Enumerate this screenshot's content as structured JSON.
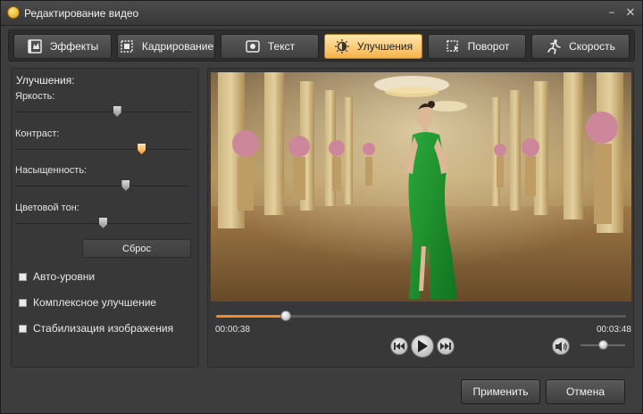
{
  "window": {
    "title": "Редактирование видео",
    "minimize_glyph": "−",
    "close_glyph": "✕"
  },
  "tabs": [
    {
      "label": "Эффекты",
      "icon": "effects-icon",
      "active": false
    },
    {
      "label": "Кадрирование",
      "icon": "crop-icon",
      "active": false
    },
    {
      "label": "Текст",
      "icon": "text-icon",
      "active": false
    },
    {
      "label": "Улучшения",
      "icon": "enhance-icon",
      "active": true
    },
    {
      "label": "Поворот",
      "icon": "rotate-icon",
      "active": false
    },
    {
      "label": "Скорость",
      "icon": "speed-icon",
      "active": false
    }
  ],
  "enhancements": {
    "heading": "Улучшения:",
    "sliders": [
      {
        "label": "Яркость:",
        "value": 0.58
      },
      {
        "label": "Контраст:",
        "value": 0.72
      },
      {
        "label": "Насыщенность:",
        "value": 0.63
      },
      {
        "label": "Цветовой тон:",
        "value": 0.5
      }
    ],
    "reset_label": "Сброс",
    "checkboxes": [
      {
        "label": "Авто-уровни",
        "checked": false
      },
      {
        "label": "Комплексное улучшение",
        "checked": false
      },
      {
        "label": "Стабилизация изображения",
        "checked": false
      }
    ]
  },
  "player": {
    "current_time": "00:00:38",
    "total_time": "00:03:48",
    "progress": 0.17,
    "volume": 0.5
  },
  "footer": {
    "apply_label": "Применить",
    "cancel_label": "Отмена"
  },
  "colors": {
    "accent": "#f08a2a",
    "active_tab": "#f5b24a",
    "dress_green": "#1f8f2e"
  }
}
